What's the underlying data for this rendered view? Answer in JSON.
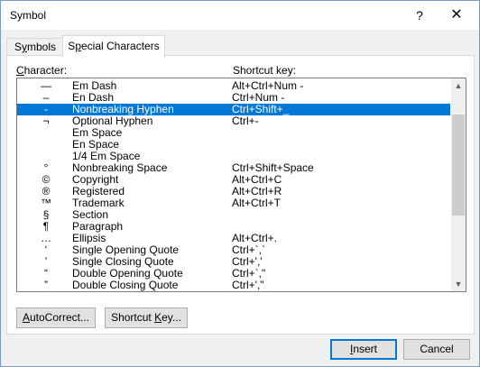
{
  "window": {
    "title": "Symbol",
    "help_glyph": "?",
    "close_glyph": "✕"
  },
  "tabs": [
    {
      "label": "Symbols",
      "active": false
    },
    {
      "label": "Special Characters",
      "active": true
    }
  ],
  "columns": {
    "character": "Character:",
    "shortcut": "Shortcut key:"
  },
  "rows": [
    {
      "symbol": "—",
      "name": "Em Dash",
      "shortcut": "Alt+Ctrl+Num -",
      "selected": false
    },
    {
      "symbol": "–",
      "name": "En Dash",
      "shortcut": "Ctrl+Num -",
      "selected": false
    },
    {
      "symbol": "-",
      "name": "Nonbreaking Hyphen",
      "shortcut": "Ctrl+Shift+_",
      "selected": true
    },
    {
      "symbol": "¬",
      "name": "Optional Hyphen",
      "shortcut": "Ctrl+-",
      "selected": false
    },
    {
      "symbol": "",
      "name": "Em Space",
      "shortcut": "",
      "selected": false
    },
    {
      "symbol": "",
      "name": "En Space",
      "shortcut": "",
      "selected": false
    },
    {
      "symbol": "",
      "name": "1/4 Em Space",
      "shortcut": "",
      "selected": false
    },
    {
      "symbol": "°",
      "name": "Nonbreaking Space",
      "shortcut": "Ctrl+Shift+Space",
      "selected": false
    },
    {
      "symbol": "©",
      "name": "Copyright",
      "shortcut": "Alt+Ctrl+C",
      "selected": false
    },
    {
      "symbol": "®",
      "name": "Registered",
      "shortcut": "Alt+Ctrl+R",
      "selected": false
    },
    {
      "symbol": "™",
      "name": "Trademark",
      "shortcut": "Alt+Ctrl+T",
      "selected": false
    },
    {
      "symbol": "§",
      "name": "Section",
      "shortcut": "",
      "selected": false
    },
    {
      "symbol": "¶",
      "name": "Paragraph",
      "shortcut": "",
      "selected": false
    },
    {
      "symbol": "…",
      "name": "Ellipsis",
      "shortcut": "Alt+Ctrl+.",
      "selected": false
    },
    {
      "symbol": "‘",
      "name": "Single Opening Quote",
      "shortcut": "Ctrl+`,`",
      "selected": false
    },
    {
      "symbol": "’",
      "name": "Single Closing Quote",
      "shortcut": "Ctrl+','",
      "selected": false
    },
    {
      "symbol": "“",
      "name": "Double Opening Quote",
      "shortcut": "Ctrl+`,\"",
      "selected": false
    },
    {
      "symbol": "”",
      "name": "Double Closing Quote",
      "shortcut": "Ctrl+',\"",
      "selected": false
    }
  ],
  "buttons": {
    "autocorrect": "AutoCorrect...",
    "shortcut_key": "Shortcut Key...",
    "insert": "Insert",
    "cancel": "Cancel"
  },
  "colors": {
    "selection": "#0078d7"
  }
}
